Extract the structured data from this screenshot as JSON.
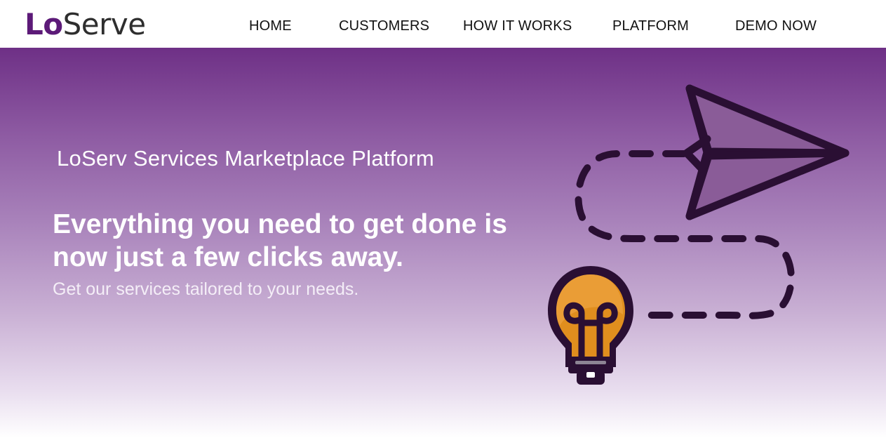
{
  "header": {
    "logo": {
      "part1": "Lo",
      "part2": "Serve"
    },
    "nav": [
      {
        "id": "home",
        "label": "HOME"
      },
      {
        "id": "customers",
        "label": "CUSTOMERS"
      },
      {
        "id": "how-it-works",
        "label": "HOW IT WORKS"
      },
      {
        "id": "platform",
        "label": "PLATFORM"
      },
      {
        "id": "demo-now",
        "label": "DEMO NOW"
      }
    ]
  },
  "hero": {
    "subtitle": "LoServ Services Marketplace Platform",
    "headline": "Everything you need to get done is now just a few clicks away.",
    "tagline": "Get our services tailored to your needs.",
    "illustration": {
      "icons": [
        "paper-plane-icon",
        "light-bulb-icon",
        "dashed-path"
      ]
    }
  },
  "colors": {
    "brand_purple": "#5c1a78",
    "gradient_top": "#6e3086",
    "icon_dark": "#2a0f33",
    "bulb_orange": "#e08e1e",
    "plane_fill": "#8a5c98"
  }
}
